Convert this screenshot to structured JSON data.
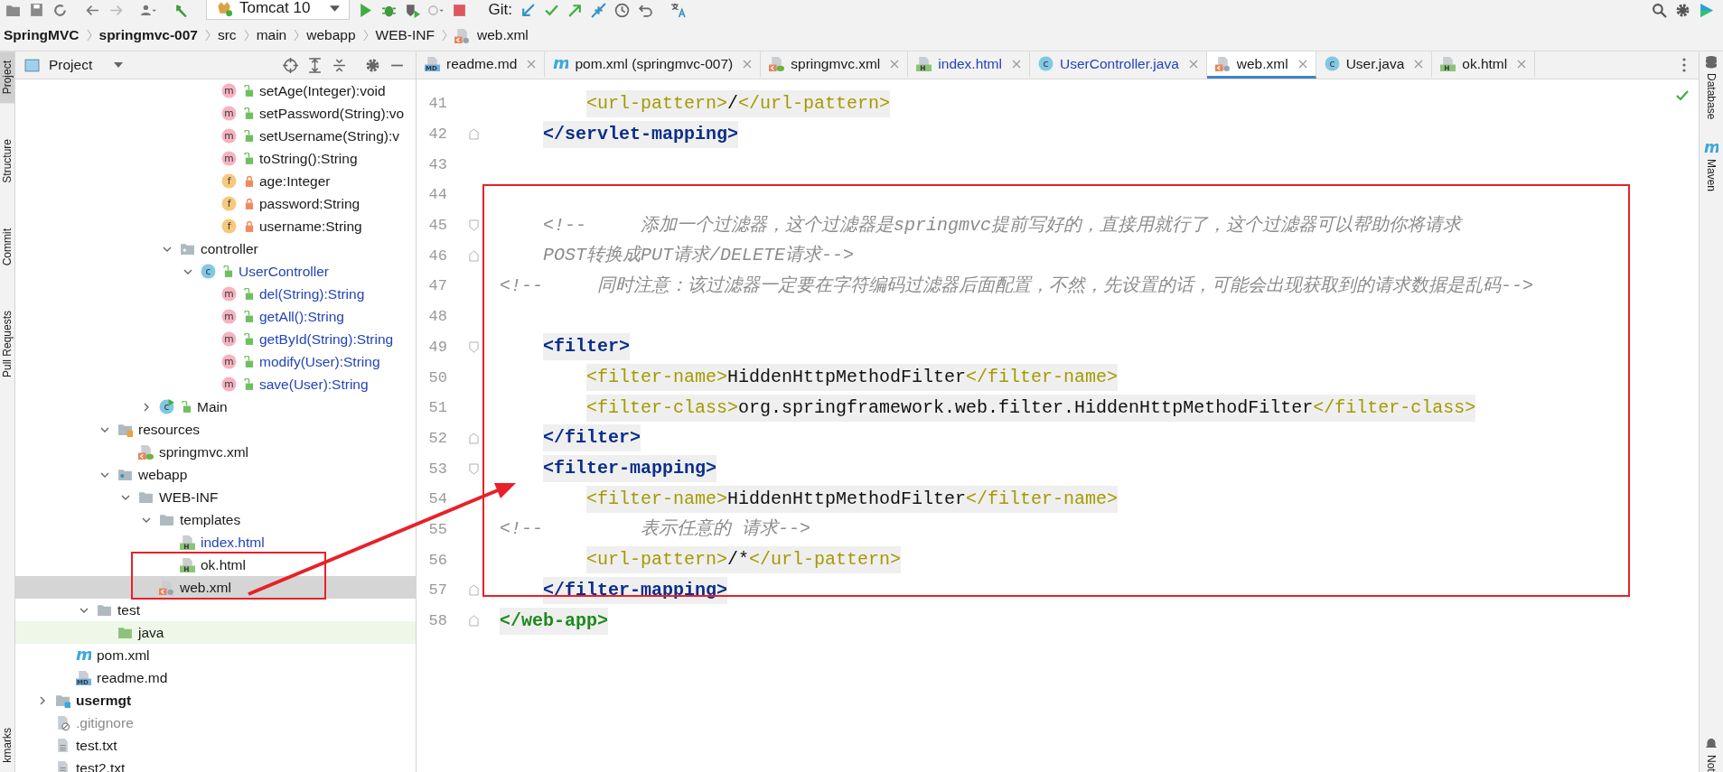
{
  "toolbar": {
    "run_config": "Tomcat 10",
    "git_label": "Git:"
  },
  "breadcrumbs": [
    {
      "label": "SpringMVC",
      "kind": "module"
    },
    {
      "label": "springmvc-007",
      "kind": "module"
    },
    {
      "label": "src",
      "kind": "folder"
    },
    {
      "label": "main",
      "kind": "folder"
    },
    {
      "label": "webapp",
      "kind": "folder"
    },
    {
      "label": "WEB-INF",
      "kind": "folder"
    },
    {
      "label": "web.xml",
      "kind": "xml_file"
    }
  ],
  "left_strip": [
    {
      "label": "Project",
      "selected": true
    },
    {
      "label": "Structure",
      "selected": false
    },
    {
      "label": "Commit",
      "selected": false
    },
    {
      "label": "Pull Requests",
      "selected": false
    },
    {
      "label": "kmarks",
      "selected": false
    }
  ],
  "project_panel": {
    "title": "Project",
    "tree": [
      {
        "children": [
          {
            "children": [
              {
                "children": [
                  {
                    "children": [
                      {
                        "children": [
                          {
                            "children": [
                              {
                                "children": [
                                  {
                                    "children": [
                                      {
                                        "label": "setAge(Integer):void",
                                        "kind": "method",
                                        "icon_text": "m",
                                        "private": false,
                                        "modified": false,
                                        "selected": false
                                      },
                                      {
                                        "label": "setPassword(String):vo",
                                        "kind": "method",
                                        "icon_text": "m",
                                        "private": false,
                                        "modified": false,
                                        "selected": false
                                      },
                                      {
                                        "label": "setUsername(String):v",
                                        "kind": "method",
                                        "icon_text": "m",
                                        "private": false,
                                        "modified": false,
                                        "selected": false
                                      },
                                      {
                                        "label": "toString():String",
                                        "kind": "method",
                                        "icon_text": "m",
                                        "private": false,
                                        "modified": false,
                                        "selected": false
                                      },
                                      {
                                        "label": "age:Integer",
                                        "kind": "field",
                                        "icon_text": "f",
                                        "private": true,
                                        "modified": false,
                                        "selected": false
                                      },
                                      {
                                        "label": "password:String",
                                        "kind": "field",
                                        "icon_text": "f",
                                        "private": true,
                                        "modified": false,
                                        "selected": false
                                      },
                                      {
                                        "label": "username:String",
                                        "kind": "field",
                                        "icon_text": "f",
                                        "private": true,
                                        "modified": false,
                                        "selected": false
                                      }
                                    ]
                                  }
                                ]
                              },
                              {
                                "label": "controller",
                                "kind": "package",
                                "modified": false,
                                "selected": false,
                                "expanded": true,
                                "children": [
                                  {
                                    "label": "UserController",
                                    "kind": "class",
                                    "icon_text": "c",
                                    "private": false,
                                    "modified": true,
                                    "selected": false,
                                    "expanded": true,
                                    "children": [
                                      {
                                        "label": "del(String):String",
                                        "kind": "method",
                                        "icon_text": "m",
                                        "private": false,
                                        "modified": true,
                                        "selected": false
                                      },
                                      {
                                        "label": "getAll():String",
                                        "kind": "method",
                                        "icon_text": "m",
                                        "private": false,
                                        "modified": true,
                                        "selected": false
                                      },
                                      {
                                        "label": "getById(String):String",
                                        "kind": "method",
                                        "icon_text": "m",
                                        "private": false,
                                        "modified": true,
                                        "selected": false
                                      },
                                      {
                                        "label": "modify(User):String",
                                        "kind": "method",
                                        "icon_text": "m",
                                        "private": false,
                                        "modified": true,
                                        "selected": false
                                      },
                                      {
                                        "label": "save(User):String",
                                        "kind": "method",
                                        "icon_text": "m",
                                        "private": false,
                                        "modified": true,
                                        "selected": false
                                      }
                                    ]
                                  }
                                ]
                              }
                            ]
                          },
                          {
                            "label": "Main",
                            "kind": "main_class",
                            "icon_text": "c",
                            "private": false,
                            "modified": false,
                            "selected": false,
                            "expanded": false
                          }
                        ]
                      }
                    ]
                  },
                  {
                    "label": "resources",
                    "kind": "resources_folder",
                    "modified": false,
                    "selected": false,
                    "expanded": true,
                    "children": [
                      {
                        "label": "springmvc.xml",
                        "kind": "spring_xml",
                        "modified": false,
                        "selected": false
                      }
                    ]
                  },
                  {
                    "label": "webapp",
                    "kind": "web_folder",
                    "modified": false,
                    "selected": false,
                    "expanded": true,
                    "children": [
                      {
                        "label": "WEB-INF",
                        "kind": "folder",
                        "modified": false,
                        "selected": false,
                        "expanded": true,
                        "children": [
                          {
                            "label": "templates",
                            "kind": "folder",
                            "modified": false,
                            "selected": false,
                            "expanded": true,
                            "children": [
                              {
                                "label": "index.html",
                                "kind": "html_file",
                                "icon_text": "H",
                                "modified": true,
                                "selected": false
                              },
                              {
                                "label": "ok.html",
                                "kind": "html_file",
                                "icon_text": "H",
                                "modified": false,
                                "selected": false
                              }
                            ]
                          },
                          {
                            "label": "web.xml",
                            "kind": "xml_file",
                            "modified": false,
                            "selected": true
                          }
                        ]
                      }
                    ]
                  }
                ]
              },
              {
                "label": "test",
                "kind": "folder",
                "modified": false,
                "selected": false,
                "expanded": true,
                "children": [
                  {
                    "label": "java",
                    "kind": "test_folder",
                    "modified": false,
                    "selected": false
                  }
                ]
              }
            ]
          },
          {
            "label": "pom.xml",
            "kind": "maven",
            "icon_text": "m",
            "modified": false,
            "selected": false
          },
          {
            "label": "readme.md",
            "kind": "markdown",
            "icon_text": "MD",
            "modified": false,
            "selected": false
          }
        ]
      },
      {
        "label": "usermgt",
        "kind": "module",
        "modified": false,
        "selected": false,
        "expanded": false
      },
      {
        "label": ".gitignore",
        "kind": "gitignore",
        "modified": false,
        "selected": false
      },
      {
        "label": "test.txt",
        "kind": "text_file",
        "modified": false,
        "selected": false
      },
      {
        "label": "test2.txt",
        "kind": "text_file",
        "modified": false,
        "selected": false
      }
    ]
  },
  "tabs": [
    {
      "label": "readme.md",
      "kind": "markdown",
      "icon_text": "MD",
      "modified": false,
      "selected": false
    },
    {
      "label": "pom.xml (springmvc-007)",
      "kind": "maven",
      "icon_text": "m",
      "modified": false,
      "selected": false
    },
    {
      "label": "springmvc.xml",
      "kind": "spring_xml",
      "modified": false,
      "selected": false
    },
    {
      "label": "index.html",
      "kind": "html_file",
      "icon_text": "H",
      "modified": true,
      "selected": false
    },
    {
      "label": "UserController.java",
      "kind": "class",
      "icon_text": "c",
      "modified": true,
      "selected": false
    },
    {
      "label": "web.xml",
      "kind": "xml_file",
      "modified": false,
      "selected": true
    },
    {
      "label": "User.java",
      "kind": "class",
      "icon_text": "c",
      "modified": false,
      "selected": false
    },
    {
      "label": "ok.html",
      "kind": "html_file",
      "icon_text": "H",
      "modified": false,
      "selected": false
    }
  ],
  "editor": {
    "lines": [
      {
        "number": "41",
        "tokens": [
          {
            "kind": "inner_tag",
            "text": "        <url-pattern>"
          },
          {
            "kind": "text",
            "text": "/"
          },
          {
            "kind": "inner_tag",
            "text": "</url-pattern>"
          }
        ]
      },
      {
        "number": "42",
        "fold_start": false,
        "tokens": [
          {
            "kind": "outer_tag",
            "text": "    </servlet-mapping>"
          }
        ]
      },
      {
        "number": "43"
      },
      {
        "number": "44"
      },
      {
        "number": "45",
        "fold_start": true,
        "tokens": [
          {
            "kind": "comment",
            "text": "    <!--     添加一个过滤器，这个过滤器是springmvc提前写好的，直接用就行了，这个过滤器可以帮助你将请求"
          }
        ]
      },
      {
        "number": "46",
        "fold_start": false,
        "tokens": [
          {
            "kind": "comment",
            "text": "    POST转换成PUT请求/DELETE请求-->"
          }
        ]
      },
      {
        "number": "47",
        "tokens": [
          {
            "kind": "comment",
            "text": "<!--     同时注意：该过滤器一定要在字符编码过滤器后面配置，不然，先设置的话，可能会出现获取到的请求数据是乱码-->"
          }
        ]
      },
      {
        "number": "48"
      },
      {
        "number": "49",
        "fold_start": true,
        "tokens": [
          {
            "kind": "outer_tag",
            "text": "    <filter>"
          }
        ]
      },
      {
        "number": "50",
        "tokens": [
          {
            "kind": "inner_tag",
            "text": "        <filter-name>"
          },
          {
            "kind": "text",
            "text": "HiddenHttpMethodFilter"
          },
          {
            "kind": "inner_tag",
            "text": "</filter-name>"
          }
        ]
      },
      {
        "number": "51",
        "tokens": [
          {
            "kind": "inner_tag",
            "text": "        <filter-class>"
          },
          {
            "kind": "text",
            "text": "org.springframework.web.filter.HiddenHttpMethodFilter"
          },
          {
            "kind": "inner_tag",
            "text": "</filter-class>"
          }
        ]
      },
      {
        "number": "52",
        "fold_start": false,
        "tokens": [
          {
            "kind": "outer_tag",
            "text": "    </filter>"
          }
        ]
      },
      {
        "number": "53",
        "fold_start": true,
        "tokens": [
          {
            "kind": "outer_tag",
            "text": "    <filter-mapping>"
          }
        ]
      },
      {
        "number": "54",
        "tokens": [
          {
            "kind": "inner_tag",
            "text": "        <filter-name>"
          },
          {
            "kind": "text",
            "text": "HiddenHttpMethodFilter"
          },
          {
            "kind": "inner_tag",
            "text": "</filter-name>"
          }
        ]
      },
      {
        "number": "55",
        "tokens": [
          {
            "kind": "comment",
            "text": "<!--         表示任意的 请求-->"
          }
        ]
      },
      {
        "number": "56",
        "tokens": [
          {
            "kind": "inner_tag",
            "text": "        <url-pattern>"
          },
          {
            "kind": "text",
            "text": "/*"
          },
          {
            "kind": "inner_tag",
            "text": "</url-pattern>"
          }
        ]
      },
      {
        "number": "57",
        "fold_start": false,
        "tokens": [
          {
            "kind": "outer_tag",
            "text": "    </filter-mapping>"
          }
        ]
      },
      {
        "number": "58",
        "fold_start": false,
        "tokens": [
          {
            "kind": "root_tag",
            "text": "</web-app>"
          }
        ]
      }
    ]
  },
  "right_strip": [
    {
      "label": "Database",
      "kind": "database"
    },
    {
      "label": "Maven",
      "kind": "maven",
      "icon_text": "m"
    },
    {
      "label": "Not",
      "kind": "bell"
    }
  ]
}
